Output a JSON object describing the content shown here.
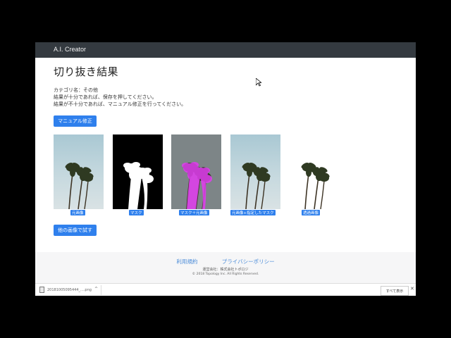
{
  "app": {
    "brand": "A.I. Creator"
  },
  "page": {
    "title": "切り抜き結果",
    "category_line": "カテゴリ名：その他",
    "line_save": "結果が十分であれば、保存を押してください。",
    "line_manual": "結果が不十分であれば、マニュアル修正を行ってください。"
  },
  "buttons": {
    "manual_fix": "マニュアル修正",
    "try_other": "他の画像で試す"
  },
  "results": [
    {
      "caption": "元画像"
    },
    {
      "caption": "マスク"
    },
    {
      "caption": "マスク＋元画像"
    },
    {
      "caption": "元画像+指定したマスク"
    },
    {
      "caption": "透過画像"
    }
  ],
  "footer": {
    "terms": "利用規約",
    "privacy": "プライバシーポリシー",
    "operator": "運営会社：株式会社トポロジ",
    "copyright": "© 2018 Topology Inc. All Rights Reserved."
  },
  "downloads": {
    "file_name": "20181005095444_....png",
    "show_all": "すべて表示"
  },
  "colors": {
    "navbar": "#343a40",
    "primary": "#2f80ed",
    "mask_overlay": "#e23cf0",
    "link": "#4a8bd8"
  }
}
